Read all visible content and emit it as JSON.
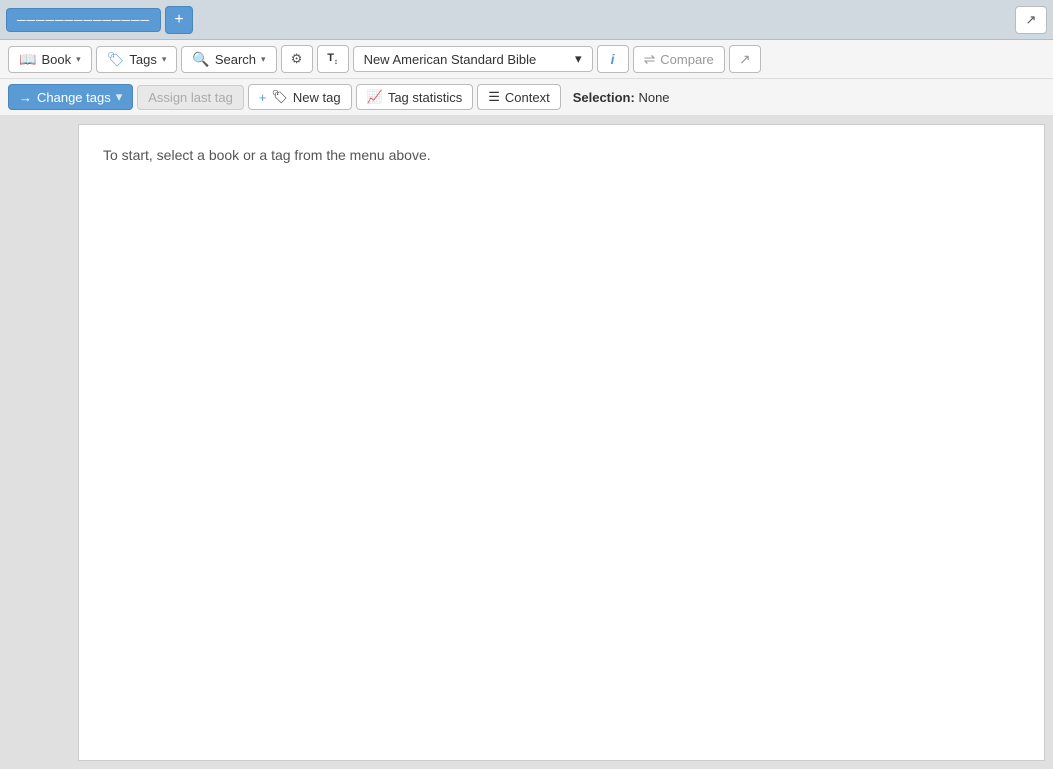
{
  "topbar": {
    "title": "──────────────",
    "add_label": "+",
    "expand_label": "⤢"
  },
  "toolbar1": {
    "book_label": "Book",
    "tags_label": "Tags",
    "search_label": "Search",
    "gear_title": "Settings",
    "font_label": "T↕",
    "bible_version": "New American Standard Bible",
    "info_label": "i",
    "compare_label": "Compare",
    "export_label": "↗"
  },
  "toolbar2": {
    "change_tags_label": "Change tags",
    "assign_last_tag_label": "Assign last tag",
    "new_tag_label": "New tag",
    "tag_statistics_label": "Tag statistics",
    "context_label": "Context",
    "selection_label": "Selection:",
    "selection_value": "None"
  },
  "content": {
    "intro_text": "To start, select a book or a tag from the menu above."
  }
}
